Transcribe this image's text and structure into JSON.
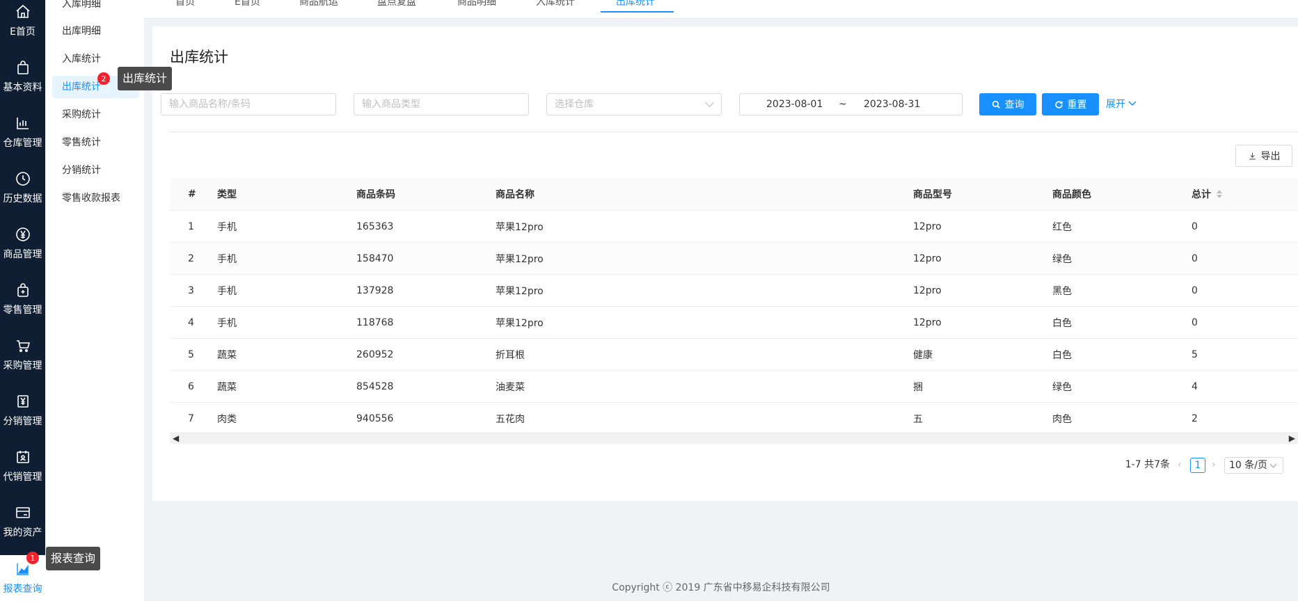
{
  "rail": [
    {
      "label": "E首页",
      "icon": "home-icon"
    },
    {
      "label": "基本资料",
      "icon": "bag-icon"
    },
    {
      "label": "仓库管理",
      "icon": "bar-chart-icon"
    },
    {
      "label": "历史数据",
      "icon": "clock-icon"
    },
    {
      "label": "商品管理",
      "icon": "yen-icon"
    },
    {
      "label": "零售管理",
      "icon": "shop-bag-plus-icon"
    },
    {
      "label": "采购管理",
      "icon": "cart-icon"
    },
    {
      "label": "分销管理",
      "icon": "yen-box-icon"
    },
    {
      "label": "代销管理",
      "icon": "calendar-user-icon"
    },
    {
      "label": "我的资产",
      "icon": "card-icon"
    },
    {
      "label": "报表查询",
      "icon": "area-chart-icon"
    }
  ],
  "submenu": [
    "入库明细",
    "出库明细",
    "入库统计",
    "出库统计",
    "采购统计",
    "零售统计",
    "分销统计",
    "零售收款报表"
  ],
  "tabs": [
    "首页",
    "E首页",
    "商品航运",
    "盘点复盘",
    "商品明细",
    "入库统计",
    "出库统计"
  ],
  "page_title": "出库统计",
  "filters": {
    "name_placeholder": "输入商品名称/条码",
    "type_placeholder": "输入商品类型",
    "warehouse_placeholder": "选择仓库",
    "date_start": "2023-08-01",
    "date_sep": "~",
    "date_end": "2023-08-31",
    "search_label": "查询",
    "reset_label": "重置",
    "expand_label": "展开"
  },
  "export_label": "导出",
  "table": {
    "headers": [
      "#",
      "类型",
      "商品条码",
      "商品名称",
      "商品型号",
      "商品颜色",
      "总计"
    ],
    "rows": [
      [
        "1",
        "手机",
        "165363",
        "苹果12pro",
        "12pro",
        "红色",
        "0"
      ],
      [
        "2",
        "手机",
        "158470",
        "苹果12pro",
        "12pro",
        "绿色",
        "0"
      ],
      [
        "3",
        "手机",
        "137928",
        "苹果12pro",
        "12pro",
        "黑色",
        "0"
      ],
      [
        "4",
        "手机",
        "118768",
        "苹果12pro",
        "12pro",
        "白色",
        "0"
      ],
      [
        "5",
        "蔬菜",
        "260952",
        "折耳根",
        "健康",
        "白色",
        "5"
      ],
      [
        "6",
        "蔬菜",
        "854528",
        "油麦菜",
        "捆",
        "绿色",
        "4"
      ],
      [
        "7",
        "肉类",
        "940556",
        "五花肉",
        "五",
        "肉色",
        "2"
      ]
    ]
  },
  "pagination": {
    "total": "1-7 共7条",
    "prev": "‹",
    "current": "1",
    "next": "›",
    "page_size": "10 条/页"
  },
  "footer": "Copyright ⓒ 2019 广东省中移易企科技有限公司",
  "tooltips": {
    "outbound_badge": "2",
    "outbound_tip": "出库统计",
    "report_badge": "1",
    "report_tip": "报表查询"
  },
  "colors": {
    "primary": "#1890ff",
    "rail_bg": "#0f1e33",
    "badge": "#f5222d"
  }
}
